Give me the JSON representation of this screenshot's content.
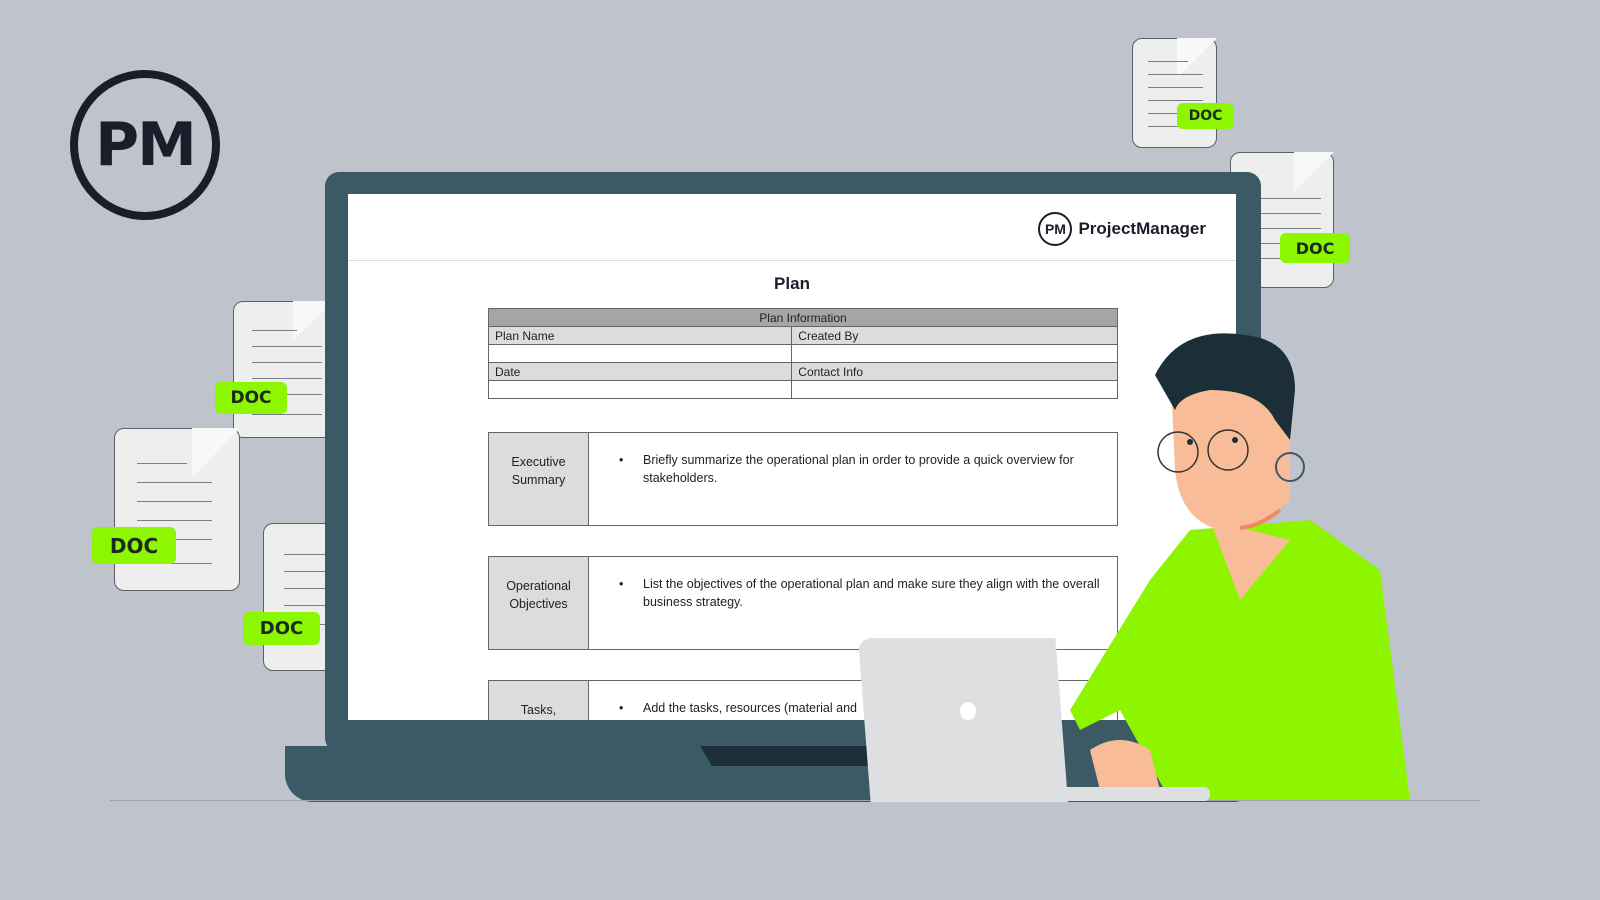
{
  "background_logo": {
    "text": "PM"
  },
  "floating_docs": [
    {
      "badge": "DOC"
    },
    {
      "badge": "DOC"
    },
    {
      "badge": "DOC"
    },
    {
      "badge": "DOC"
    },
    {
      "badge": "DOC"
    },
    {
      "badge": "DOC"
    }
  ],
  "document": {
    "brand": {
      "logo_text": "PM",
      "name": "ProjectManager"
    },
    "title": "Plan",
    "info_table": {
      "header": "Plan Information",
      "fields": [
        {
          "label": "Plan Name",
          "value": ""
        },
        {
          "label": "Created By",
          "value": ""
        },
        {
          "label": "Date",
          "value": ""
        },
        {
          "label": "Contact Info",
          "value": ""
        }
      ]
    },
    "sections": [
      {
        "label": "Executive Summary",
        "text": "Briefly summarize the operational plan in order to provide a quick overview for stakeholders."
      },
      {
        "label": "Operational Objectives",
        "text": "List the objectives of the operational plan and make sure they align with the overall business strategy."
      },
      {
        "label": "Tasks,",
        "text": "Add the tasks, resources (material and"
      }
    ]
  },
  "colors": {
    "accent": "#8cf700",
    "monitor": "#3b5a66",
    "background": "#bfc3cc",
    "ink": "#1b1d2a"
  }
}
